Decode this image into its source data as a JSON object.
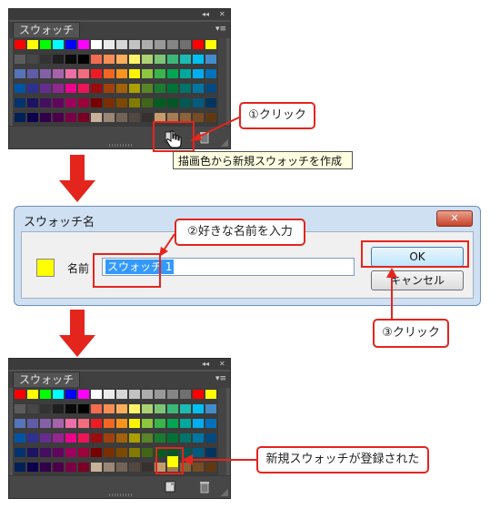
{
  "panel1": {
    "title": "スウォッチ",
    "collapse_glyph": "◂◂",
    "close_glyph": "✕",
    "menu_glyph": "▾≡",
    "tooltip": "描画色から新規スウォッチを作成"
  },
  "panel2": {
    "title": "スウォッチ",
    "collapse_glyph": "◂◂",
    "close_glyph": "✕",
    "menu_glyph": "▾≡"
  },
  "callouts": {
    "step1": "①クリック",
    "step2": "②好きな名前を入力",
    "step3": "③クリック",
    "registered": "新規スウォッチが登録された"
  },
  "dialog": {
    "title": "スウォッチ名",
    "close_glyph": "✕",
    "name_label": "名前",
    "name_value": "スウォッチ 1",
    "ok_label": "OK",
    "cancel_label": "キャンセル",
    "swatch_color": "#ffff00"
  },
  "colors": {
    "accent_red": "#e4251d",
    "panel_bg": "#535353",
    "new_swatch": "#ffff00"
  },
  "swatches": [
    [
      "#ff0000",
      "#ffff00",
      "#00ff00",
      "#00ffff",
      "#0000ff",
      "#ff00ff",
      "#ffffff",
      "#ebebeb",
      "#d6d6d6",
      "#c2c2c2",
      "#adadad",
      "#999999",
      "#858585",
      "#707070",
      "#ff0000",
      "#ffff00"
    ],
    [
      "#5c5c5c",
      "#474747",
      "#333333",
      "#1f1f1f",
      "#0a0a0a",
      "#000000",
      "#f26c4f",
      "#f68e56",
      "#fbaf5c",
      "#fff467",
      "#acd372",
      "#7cc576",
      "#3bb878",
      "#1abbb4",
      "#00bff3",
      "#438ccb"
    ],
    [
      "#5574b9",
      "#605ca8",
      "#855fa8",
      "#a763a9",
      "#ef6ea8",
      "#f16d7e",
      "#ed1c24",
      "#f26522",
      "#f7941d",
      "#fff200",
      "#8dc63f",
      "#39b54a",
      "#00a651",
      "#00a99d",
      "#00aeef",
      "#0072bc"
    ],
    [
      "#0054a5",
      "#2e3192",
      "#662d91",
      "#92278f",
      "#ec008c",
      "#ed145a",
      "#9e0b0f",
      "#a0410d",
      "#a36209",
      "#aba000",
      "#598527",
      "#1a7b30",
      "#007236",
      "#00746b",
      "#0076a4",
      "#004a80"
    ],
    [
      "#003370",
      "#1d1363",
      "#450e61",
      "#62055f",
      "#9e005d",
      "#9e0039",
      "#790000",
      "#7b2e00",
      "#7d4900",
      "#827b00",
      "#406618",
      "#005e20",
      "#005826",
      "#005952",
      "#005b7e",
      "#003562"
    ],
    [
      "#002157",
      "#0d004c",
      "#32004b",
      "#4b0049",
      "#7b0046",
      "#7a0026",
      "#c7b299",
      "#998675",
      "#736357",
      "#534741",
      "#37302d",
      "#c69c6d",
      "#a67c52",
      "#8c6239",
      "#754c24",
      "#603913"
    ]
  ],
  "new_swatch_color": "#ffff00"
}
